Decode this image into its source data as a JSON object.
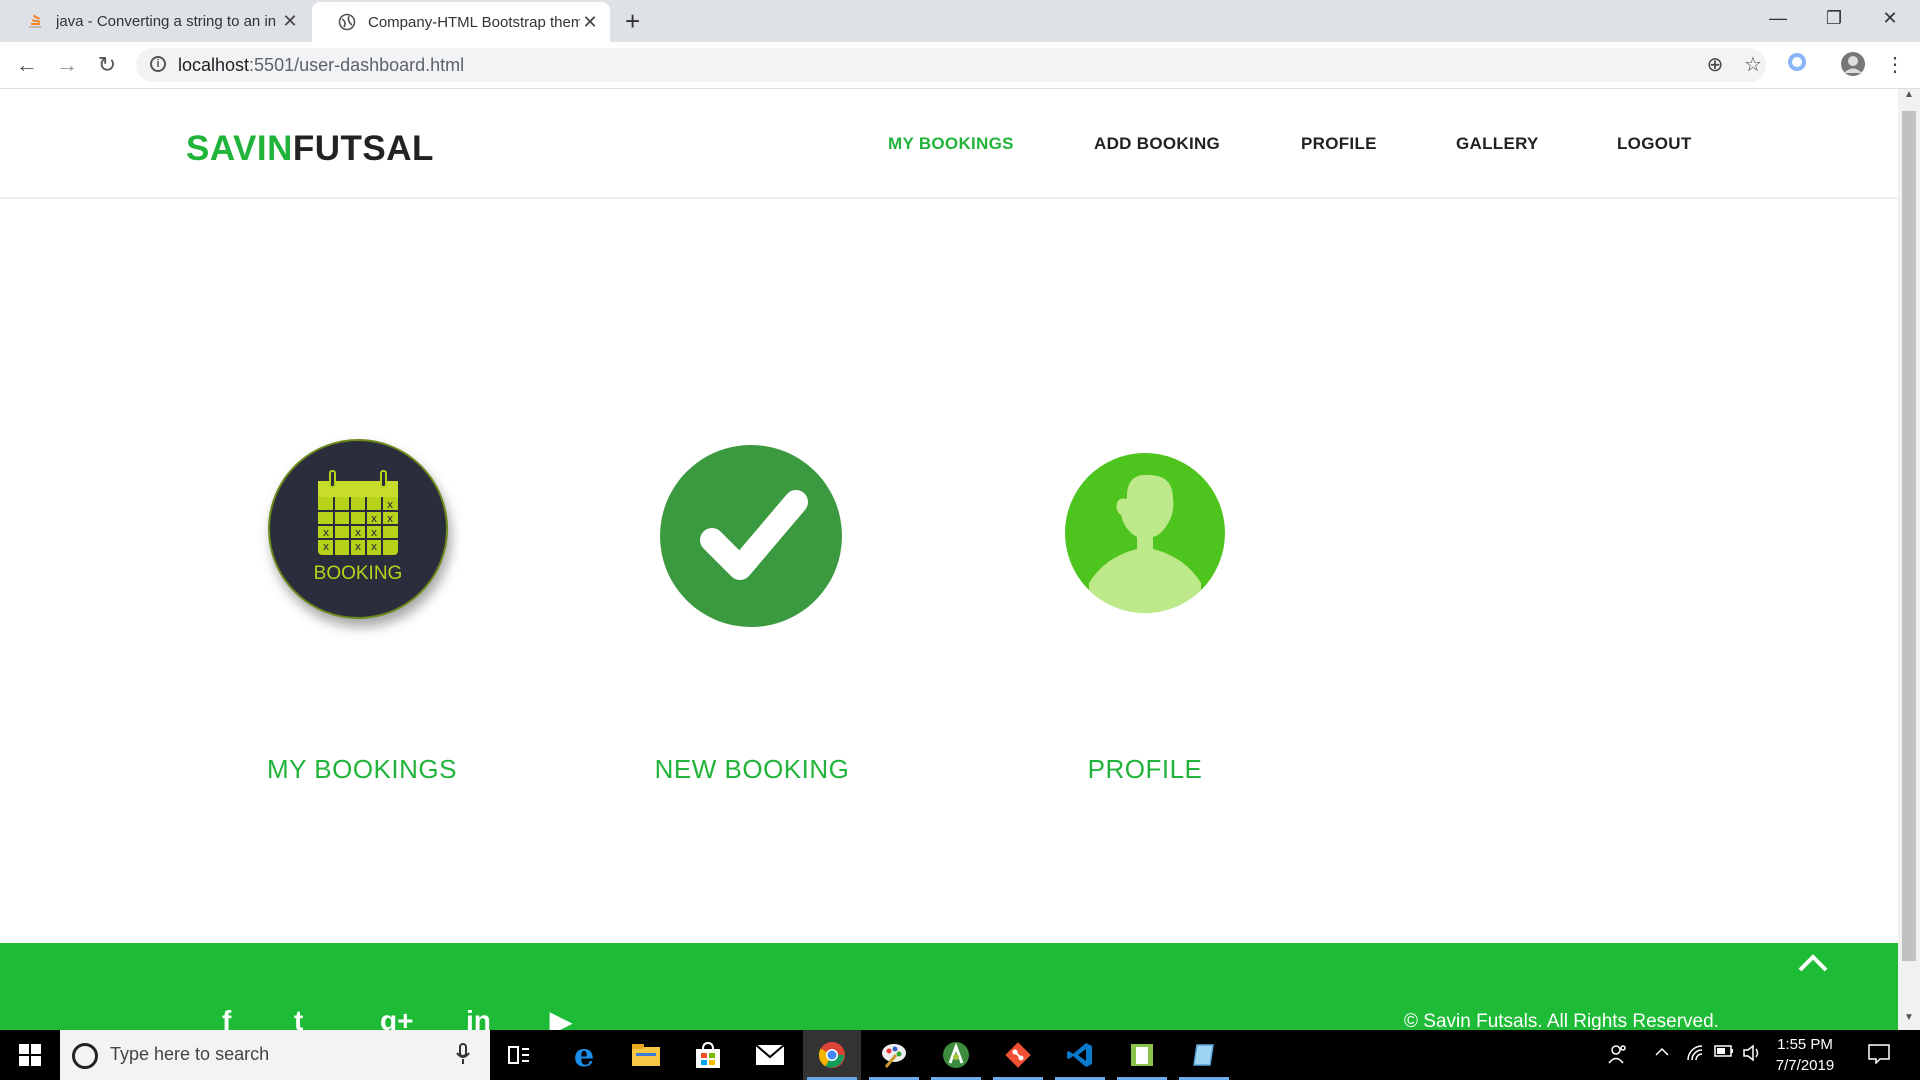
{
  "browser": {
    "tabs": [
      {
        "title": "java - Converting a string to an in",
        "close": "✕"
      },
      {
        "title": "Company-HTML Bootstrap theme",
        "close": "✕"
      }
    ],
    "new_tab": "+",
    "window_controls": {
      "minimize": "—",
      "maximize": "❐",
      "close": "✕"
    },
    "url_host": "localhost",
    "url_rest": ":5501/user-dashboard.html"
  },
  "site": {
    "logo_part1": "SAVIN",
    "logo_part2": "FUTSAL",
    "nav": [
      "MY BOOKINGS",
      "ADD BOOKING",
      "PROFILE",
      "GALLERY",
      "LOGOUT"
    ],
    "active_nav": "MY BOOKINGS",
    "accent_color": "#22b43a",
    "cards": [
      {
        "label": "MY BOOKINGS",
        "icon": "calendar-booking-icon",
        "icon_text": "BOOKING"
      },
      {
        "label": "NEW BOOKING",
        "icon": "checkmark-icon"
      },
      {
        "label": "PROFILE",
        "icon": "user-avatar-icon"
      }
    ],
    "footer": {
      "social": [
        "f",
        "t",
        "g+",
        "in",
        "▶"
      ],
      "copyright": "© Savin Futsals. All Rights Reserved.",
      "back_to_top_icon": "chevron-up-icon"
    }
  },
  "taskbar": {
    "search_placeholder": "Type here to search",
    "time": "1:55 PM",
    "date": "7/7/2019"
  }
}
